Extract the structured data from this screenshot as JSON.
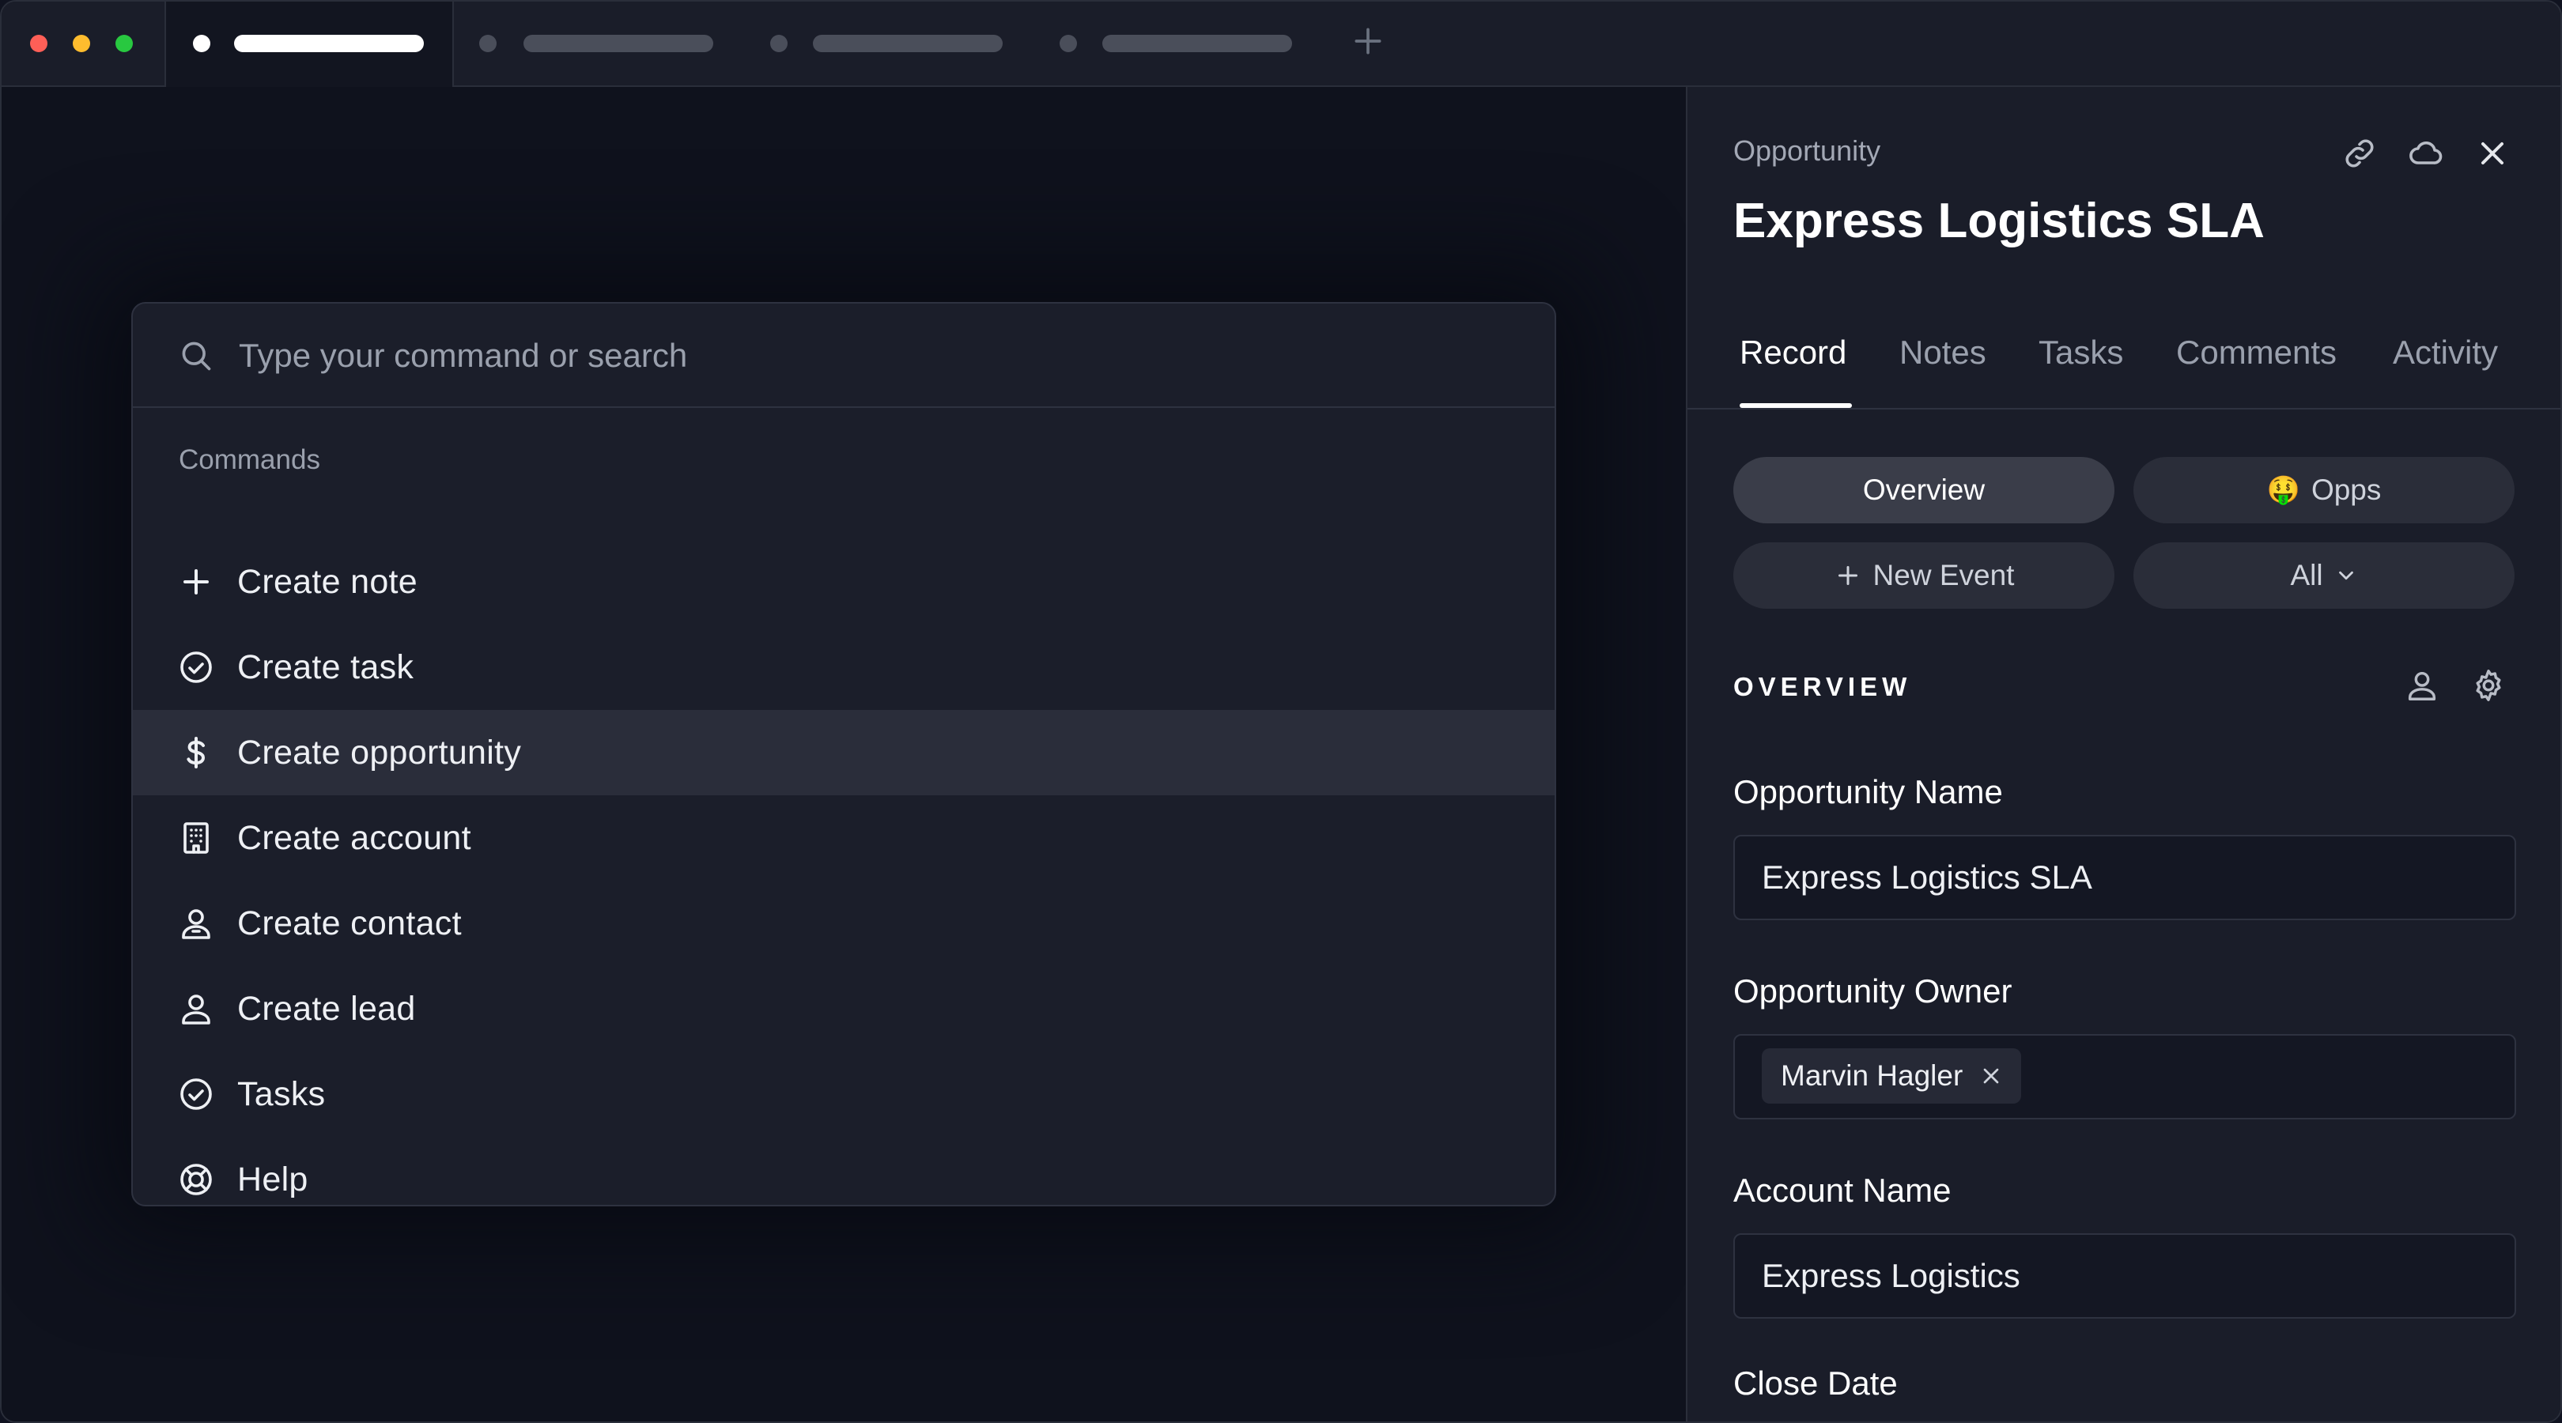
{
  "window": {
    "traffic_lights": [
      "#ff5f57",
      "#febc2e",
      "#28c840"
    ],
    "new_tab_icon": "plus-icon"
  },
  "command_palette": {
    "search_placeholder": "Type your command or search",
    "section_label": "Commands",
    "items": [
      {
        "label": "Create note",
        "icon": "plus-icon"
      },
      {
        "label": "Create task",
        "icon": "check-circle-icon"
      },
      {
        "label": "Create opportunity",
        "icon": "dollar-icon",
        "selected": true
      },
      {
        "label": "Create account",
        "icon": "building-icon"
      },
      {
        "label": "Create contact",
        "icon": "contact-icon"
      },
      {
        "label": "Create lead",
        "icon": "user-icon"
      },
      {
        "label": "Tasks",
        "icon": "check-circle-icon"
      },
      {
        "label": "Help",
        "icon": "lifebuoy-icon"
      }
    ]
  },
  "panel": {
    "kicker": "Opportunity",
    "title": "Express Logistics SLA",
    "header_icons": [
      "link-icon",
      "cloud-icon",
      "close-icon"
    ],
    "tabs": [
      "Record",
      "Notes",
      "Tasks",
      "Comments",
      "Activity"
    ],
    "active_tab": "Record",
    "buttons": {
      "overview": "Overview",
      "opps": "Opps",
      "opps_emoji": "🤑",
      "new_event": "New Event",
      "all": "All"
    },
    "overview_label": "OVERVIEW",
    "fields": {
      "opportunity_name_label": "Opportunity Name",
      "opportunity_name_value": "Express Logistics SLA",
      "opportunity_owner_label": "Opportunity Owner",
      "opportunity_owner_value": "Marvin Hagler",
      "account_name_label": "Account Name",
      "account_name_value": "Express Logistics",
      "close_date_label": "Close Date"
    }
  },
  "colors": {
    "background": "#0f121d",
    "panel": "#1a1d29",
    "palette": "#1b1e2a",
    "selected_row": "#2a2d3a",
    "text": "#eef0f4",
    "muted": "#9aa0ad"
  }
}
